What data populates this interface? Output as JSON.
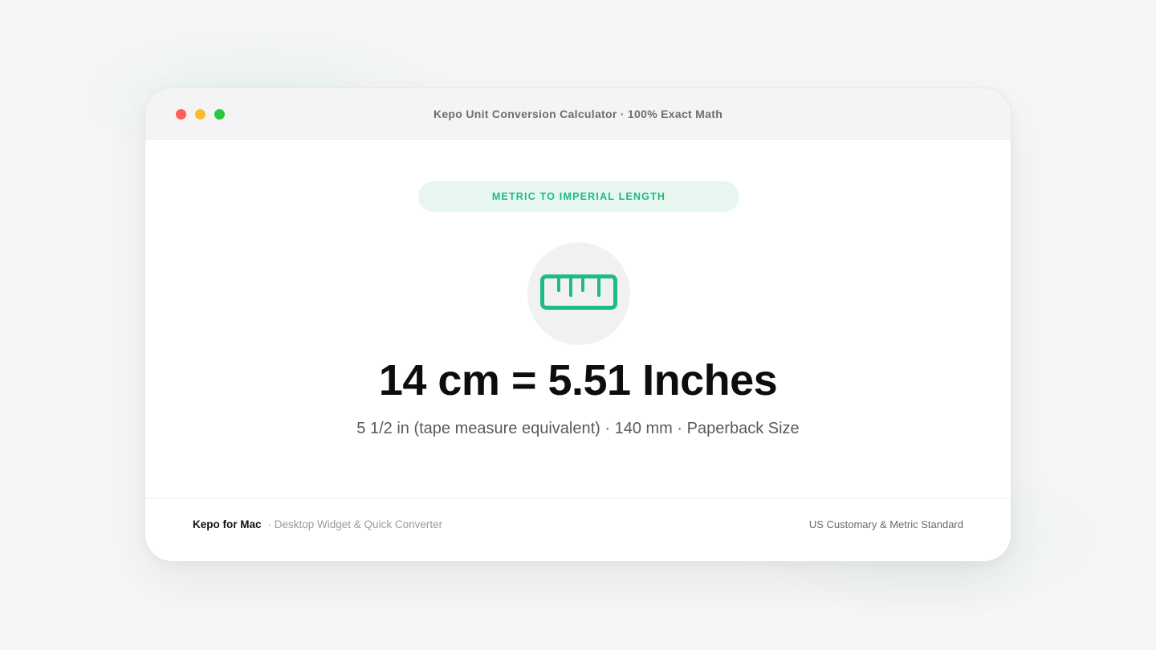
{
  "window": {
    "title": "Kepo Unit Conversion Calculator · 100% Exact Math"
  },
  "category": {
    "label": "METRIC TO IMPERIAL LENGTH"
  },
  "icon": {
    "name": "ruler-icon",
    "color": "#1dbb85"
  },
  "conversion": {
    "result": "14 cm = 5.51 Inches",
    "details": "5 1/2 in (tape measure equivalent) · 140 mm · Paperback Size"
  },
  "footer": {
    "brand": "Kepo for Mac",
    "tagline": "· Desktop Widget & Quick Converter",
    "standard": "US Customary & Metric Standard"
  },
  "colors": {
    "accent": "#1dbb85",
    "accent_bg": "#e7f6ee",
    "close": "#ff5f57",
    "minimize": "#febc2e",
    "zoom": "#28c840"
  }
}
